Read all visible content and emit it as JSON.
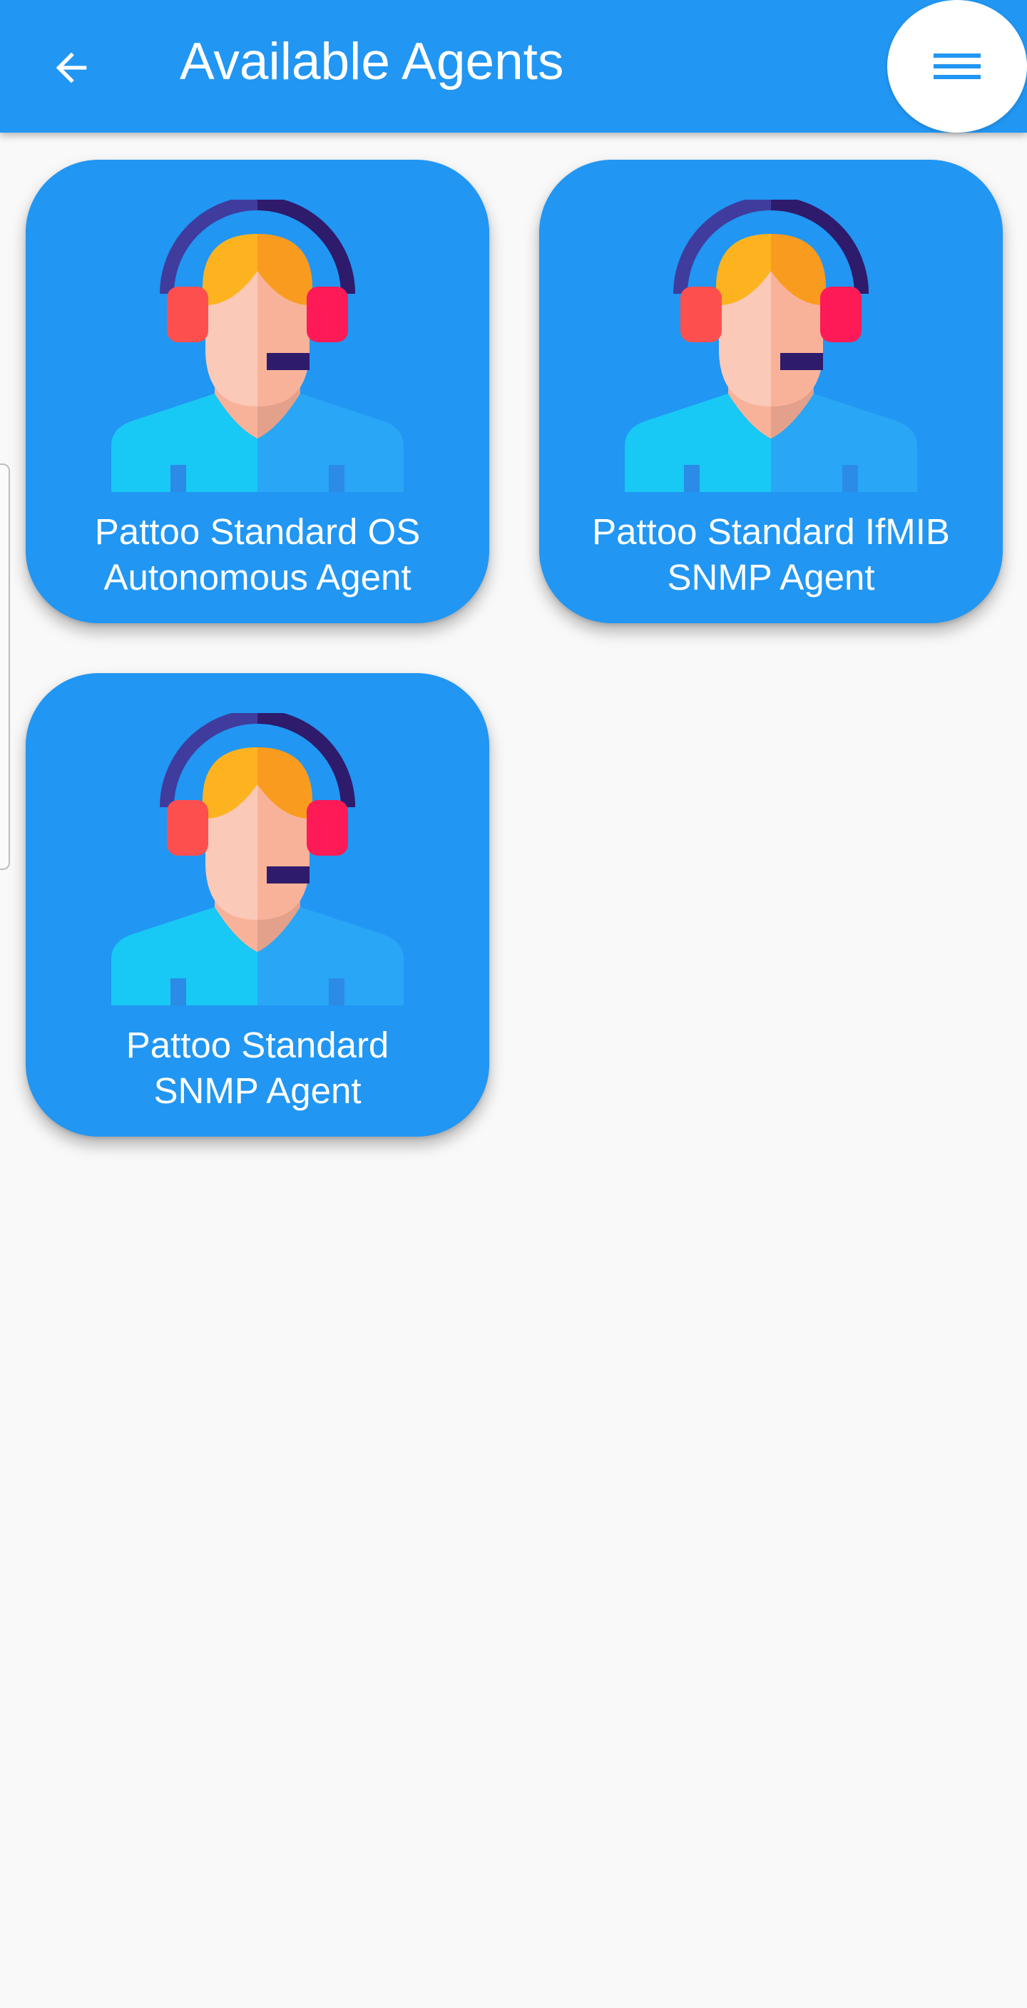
{
  "appbar": {
    "title": "Available Agents",
    "back_icon": "arrow-left-icon",
    "menu_icon": "hamburger-menu-icon",
    "color": "#2196f3"
  },
  "agents": [
    {
      "line1": "Pattoo Standard OS",
      "line2": "Autonomous Agent",
      "icon": "support-agent-headset-icon"
    },
    {
      "line1": "Pattoo Standard IfMIB",
      "line2": "SNMP Agent",
      "icon": "support-agent-headset-icon"
    },
    {
      "line1": "Pattoo Standard",
      "line2": "SNMP Agent",
      "icon": "support-agent-headset-icon"
    }
  ],
  "colors": {
    "background": "#f9f9f9",
    "card": "#2196f3",
    "text_on_primary": "#ffffff"
  }
}
